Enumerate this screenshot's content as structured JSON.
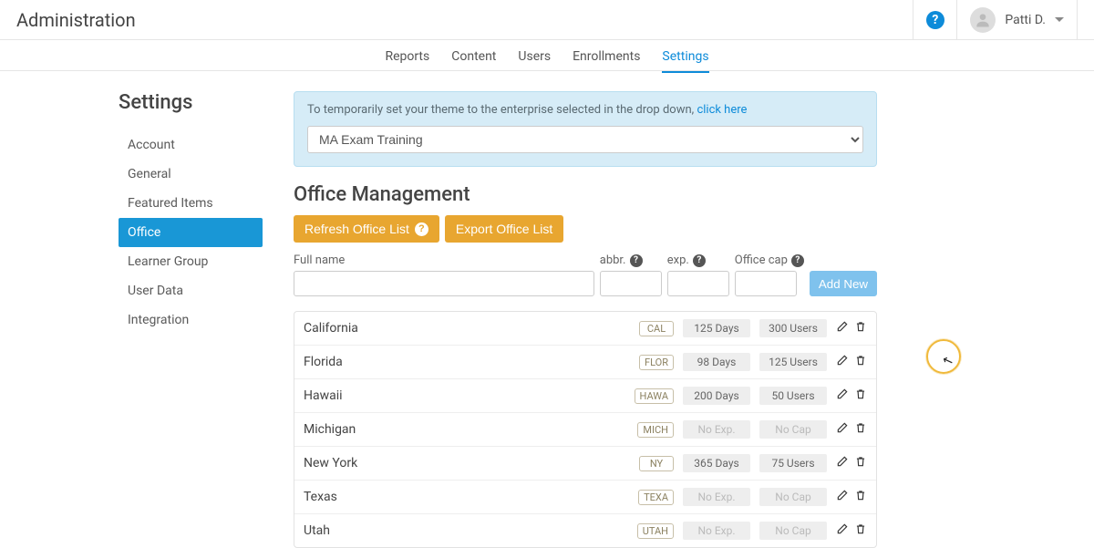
{
  "header": {
    "title": "Administration",
    "help_symbol": "?",
    "user_name": "Patti D."
  },
  "nav": {
    "items": [
      "Reports",
      "Content",
      "Users",
      "Enrollments",
      "Settings"
    ],
    "active": "Settings"
  },
  "sidebar": {
    "title": "Settings",
    "items": [
      "Account",
      "General",
      "Featured Items",
      "Office",
      "Learner Group",
      "User Data",
      "Integration"
    ],
    "active": "Office"
  },
  "banner": {
    "prefix": "To temporarily set your theme to the enterprise selected in the drop down,",
    "link": "click here",
    "select_value": "MA Exam Training"
  },
  "section": {
    "title": "Office Management"
  },
  "buttons": {
    "refresh": "Refresh Office List",
    "export": "Export Office List",
    "add": "Add New"
  },
  "form_labels": {
    "full_name": "Full name",
    "abbr": "abbr.",
    "exp": "exp.",
    "cap": "Office cap"
  },
  "offices": [
    {
      "name": "California",
      "abbr": "CAL",
      "exp": "125 Days",
      "cap": "300 Users",
      "exp_muted": false,
      "cap_muted": false
    },
    {
      "name": "Florida",
      "abbr": "FLOR",
      "exp": "98 Days",
      "cap": "125 Users",
      "exp_muted": false,
      "cap_muted": false
    },
    {
      "name": "Hawaii",
      "abbr": "HAWA",
      "exp": "200 Days",
      "cap": "50 Users",
      "exp_muted": false,
      "cap_muted": false
    },
    {
      "name": "Michigan",
      "abbr": "MICH",
      "exp": "No Exp.",
      "cap": "No Cap",
      "exp_muted": true,
      "cap_muted": true
    },
    {
      "name": "New York",
      "abbr": "NY",
      "exp": "365 Days",
      "cap": "75 Users",
      "exp_muted": false,
      "cap_muted": false
    },
    {
      "name": "Texas",
      "abbr": "TEXA",
      "exp": "No Exp.",
      "cap": "No Cap",
      "exp_muted": true,
      "cap_muted": true
    },
    {
      "name": "Utah",
      "abbr": "UTAH",
      "exp": "No Exp.",
      "cap": "No Cap",
      "exp_muted": true,
      "cap_muted": true
    }
  ]
}
